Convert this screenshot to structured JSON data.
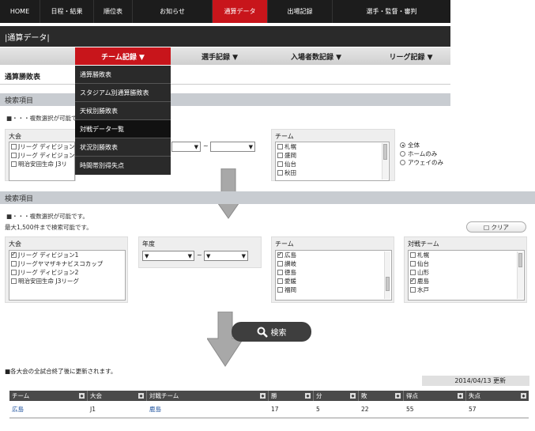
{
  "nav": {
    "items": [
      "HOME",
      "日程・結果",
      "順位表",
      "お知らせ",
      "通算データ",
      "出場記録",
      "選手・監督・審判"
    ],
    "active_index": 4
  },
  "page_title": "|通算データ|",
  "tabs": {
    "team": "チーム記録 ▼",
    "player": "選手記録 ▼",
    "attendance": "入場者数記録 ▼",
    "league": "リーグ記録 ▼"
  },
  "dropdown": {
    "items": [
      "通算勝敗表",
      "スタジアム別通算勝敗表",
      "天候別勝敗表",
      "対戦データ一覧",
      "状況別勝敗表",
      "時間帯別得失点"
    ]
  },
  "section_title": "通算勝敗表",
  "search_items_label": "検索項目",
  "top": {
    "note": "■・・・複数選択が可能で",
    "tournament_label": "大会",
    "tournament_rows": [
      "Jリーグ ディビジョン",
      "Jリーグ ディビジョン",
      "明治安田生命 J3リ"
    ],
    "team_label": "チーム",
    "team_rows": [
      "札幌",
      "盛岡",
      "仙台",
      "秋田"
    ],
    "tilde": "~",
    "select_arrow": "▼",
    "radio": [
      "全体",
      "ホームのみ",
      "アウェイのみ"
    ]
  },
  "bottom": {
    "note1": "■・・・複数選択が可能です。",
    "note2": "最大1,500件まで検索可能です。",
    "clear": "□ クリア",
    "tournament_label": "大会",
    "tournament_rows": [
      {
        "label": "Jリーグ ディビジョン1",
        "checked": true
      },
      {
        "label": "Jリーグヤマザキナビスコカップ",
        "checked": false
      },
      {
        "label": "Jリーグ ディビジョン2",
        "checked": false
      },
      {
        "label": "明治安田生命 J3リーグ",
        "checked": false
      }
    ],
    "year_label": "年度",
    "year_arrow": "▼",
    "tilde": "~",
    "team_label": "チーム",
    "team_rows": [
      {
        "label": "広島",
        "checked": true
      },
      {
        "label": "讃岐",
        "checked": false
      },
      {
        "label": "徳島",
        "checked": false
      },
      {
        "label": "愛媛",
        "checked": false
      },
      {
        "label": "福岡",
        "checked": false
      }
    ],
    "opp_label": "対戦チーム",
    "opp_rows": [
      {
        "label": "札幌",
        "checked": false
      },
      {
        "label": "仙台",
        "checked": false
      },
      {
        "label": "山形",
        "checked": false
      },
      {
        "label": "鹿島",
        "checked": true
      },
      {
        "label": "水戸",
        "checked": false
      }
    ]
  },
  "search_button": "検索",
  "update_note": "■各大会の全試合終了後に更新されます。",
  "updated": "2014/04/13  更新",
  "table": {
    "headers": [
      "チーム",
      "大会",
      "対戦チーム",
      "勝",
      "分",
      "敗",
      "得点",
      "失点"
    ],
    "sort_glyph": "◆",
    "row": [
      "広島",
      "J1",
      "鹿島",
      "17",
      "5",
      "22",
      "55",
      "57"
    ]
  },
  "colors": {
    "accent": "#c8151b",
    "nav_bg": "#1c1c1c",
    "link": "#1a4f9c"
  }
}
